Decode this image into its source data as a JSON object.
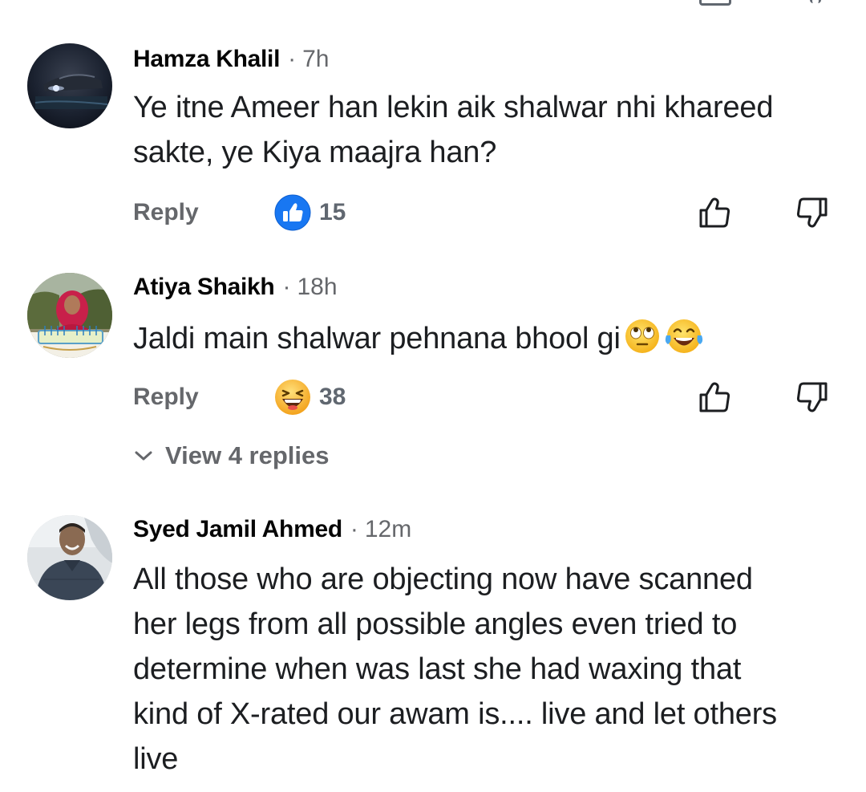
{
  "comments": [
    {
      "author": "Hamza Khalil",
      "separator": "·",
      "time": "7h",
      "text": "Ye itne Ameer han lekin aik shalwar nhi khareed sakte, ye Kiya maajra han?",
      "reply_label": "Reply",
      "reaction": {
        "type": "like",
        "count": "15"
      }
    },
    {
      "author": "Atiya Shaikh",
      "separator": "·",
      "time": "18h",
      "text": "Jaldi main shalwar pehnana bhool gi",
      "inline_emojis": [
        "face-with-rolling-eyes",
        "face-with-tears-of-joy"
      ],
      "reply_label": "Reply",
      "reaction": {
        "type": "haha",
        "count": "38"
      },
      "view_replies": "View 4 replies"
    },
    {
      "author": "Syed Jamil Ahmed",
      "separator": "·",
      "time": "12m",
      "text": "All those who are objecting now have scanned her legs from all possible angles even tried to determine when was last she had waxing that kind of X-rated our awam is.... live and let others live"
    }
  ],
  "colors": {
    "like_blue": "#1877f2",
    "secondary_text": "#65676b",
    "primary_text": "#1c1e21",
    "haha_yellow": "#f7b125"
  }
}
